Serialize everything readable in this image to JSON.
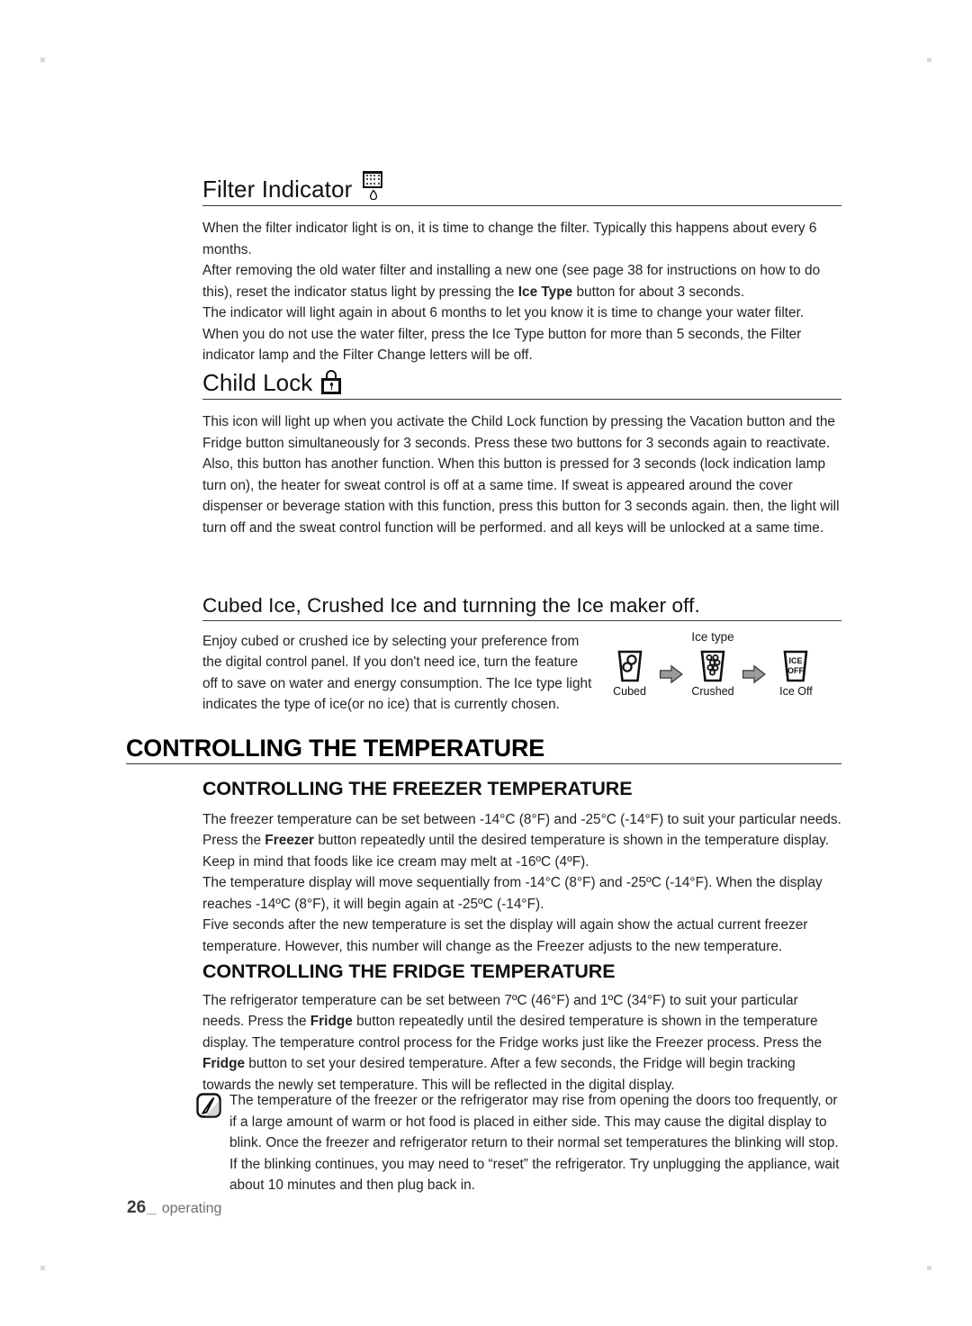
{
  "document": {
    "page_number": "26",
    "page_underscore": "_",
    "footer_section": "operating"
  },
  "sections": {
    "filter_indicator": {
      "heading": "Filter Indicator",
      "icon": "water-filter-icon",
      "paragraphs": [
        "When the filter indicator light is on, it is time to change the filter. Typically this happens about every 6 months.",
        "After removing the old water filter and installing a new one (see page 38 for instructions on how to do this), reset the indicator status light by pressing the Ice Type button for about 3 seconds.",
        "The indicator will light again in about 6 months to let you know it is time to change your water filter. When you do not use the water filter, press the Ice Type button for more than 5 seconds, the Filter indicator lamp and the Filter Change letters will be off."
      ],
      "p2_pre": "After removing the old water filter and installing a new one (see page 38 for instructions on how to do this), reset the indicator status light by pressing the ",
      "p2_bold": "Ice Type",
      "p2_post": " button for about 3 seconds."
    },
    "child_lock": {
      "heading": "Child Lock",
      "icon": "padlock-icon",
      "paragraphs": [
        "This icon will light up when you activate the Child Lock function by pressing the Vacation button and the Fridge button simultaneously for 3 seconds. Press these two buttons for 3 seconds again to reactivate.",
        "Also, this button has another function. When this button is pressed for 3 seconds (lock indication lamp turn on), the heater for sweat control is off at a same time. If sweat is appeared around the cover dispenser or beverage station with this function, press this button for 3 seconds again. then, the light will turn off and the sweat control function will be performed. and all keys will be unlocked at a same time."
      ]
    },
    "cubed_ice": {
      "heading": "Cubed Ice, Crushed Ice and turnning the Ice maker off.",
      "paragraph": "Enjoy cubed or crushed ice by selecting your preference from the digital control panel. If you don't need ice, turn the feature off to save on water and energy consumption. The Ice type light indicates the type of ice(or no ice) that is currently chosen.",
      "diagram": {
        "title": "Ice type",
        "items": [
          {
            "label": "Cubed",
            "icon": "glass-cubed-ice-icon"
          },
          {
            "label": "Crushed",
            "icon": "glass-crushed-ice-icon"
          },
          {
            "label": "Ice Off",
            "icon": "glass-ice-off-icon",
            "glass_text_line1": "ICE",
            "glass_text_line2": "OFF"
          }
        ],
        "arrow_icon": "arrow-right-icon"
      }
    },
    "controlling_temperature": {
      "heading": "CONTROLLING THE TEMPERATURE",
      "freezer": {
        "heading": "CONTROLLING THE FREEZER TEMPERATURE",
        "p1_pre": "The freezer temperature can be set between -14°C (8°F) and -25°C (-14°F) to suit your particular needs. Press the ",
        "p1_bold": "Freezer",
        "p1_post": " button repeatedly until the desired temperature is shown in the temperature display. Keep in mind that foods like ice cream may melt at -16ºC (4ºF).",
        "p2": "The temperature display will move sequentially from -14°C (8°F) and -25ºC (-14°F). When the display reaches -14ºC (8°F), it will begin again at -25ºC (-14°F).",
        "p3": "Five seconds after the new temperature is set the display will again show the actual current freezer temperature. However, this number will change as the Freezer adjusts to the new temperature."
      },
      "fridge": {
        "heading": "CONTROLLING THE FRIDGE TEMPERATURE",
        "p1_pre": "The refrigerator temperature can be set between 7ºC (46°F) and 1ºC (34°F) to suit your particular needs. Press the ",
        "p1_bold1": "Fridge",
        "p1_mid": " button repeatedly until the desired temperature is shown in the temperature display. The temperature control process for the Fridge works just like the Freezer process. Press the ",
        "p1_bold2": "Fridge",
        "p1_post": " button to set your desired temperature. After a few seconds, the Fridge will begin tracking towards the newly set temperature. This will be reflected in the digital display."
      },
      "note": {
        "icon": "note-pencil-icon",
        "text": "The temperature of the freezer or the refrigerator may rise from opening the doors too frequently, or if a large amount of warm or hot food is placed in either side. This may cause the digital display to blink. Once the freezer and refrigerator return to their normal set temperatures the blinking will stop. If the blinking continues, you may need to “reset” the refrigerator. Try unplugging the appliance, wait about 10 minutes and then plug back in."
      }
    }
  },
  "colors": {
    "text": "#242424",
    "heading": "#111111",
    "rule": "#3a3a3a",
    "arrow_fill": "#8c8c8c",
    "footer_gray": "#6e6e6e"
  }
}
